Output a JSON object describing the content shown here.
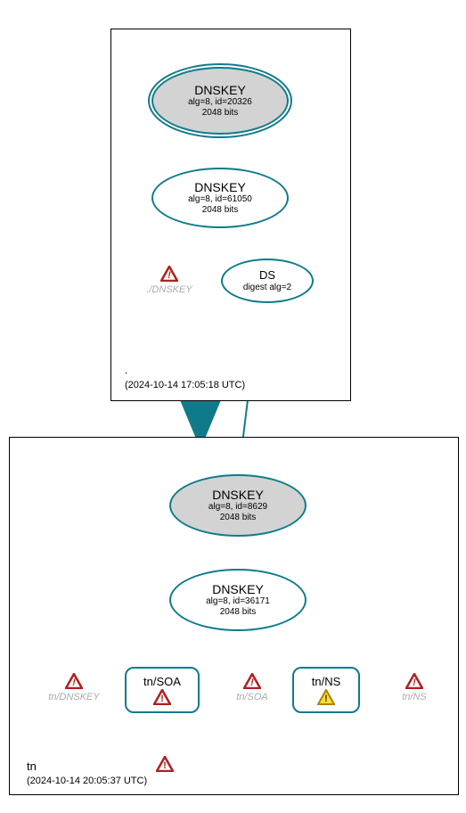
{
  "zones": {
    "root": {
      "label": ".",
      "timestamp": "(2024-10-14 17:05:18 UTC)"
    },
    "tn": {
      "label": "tn",
      "timestamp": "(2024-10-14 20:05:37 UTC)"
    }
  },
  "nodes": {
    "root_ksk": {
      "title": "DNSKEY",
      "sub1": "alg=8, id=20326",
      "sub2": "2048 bits"
    },
    "root_zsk": {
      "title": "DNSKEY",
      "sub1": "alg=8, id=61050",
      "sub2": "2048 bits"
    },
    "root_ds": {
      "title": "DS",
      "sub1": "digest alg=2"
    },
    "tn_ksk": {
      "title": "DNSKEY",
      "sub1": "alg=8, id=8629",
      "sub2": "2048 bits"
    },
    "tn_zsk": {
      "title": "DNSKEY",
      "sub1": "alg=8, id=36171",
      "sub2": "2048 bits"
    },
    "tn_soa": {
      "title": "tn/SOA"
    },
    "tn_ns": {
      "title": "tn/NS"
    }
  },
  "warnings": {
    "root_dnskey": "./DNSKEY",
    "tn_dnskey": "tn/DNSKEY",
    "tn_soa": "tn/SOA",
    "tn_ns": "tn/NS"
  }
}
